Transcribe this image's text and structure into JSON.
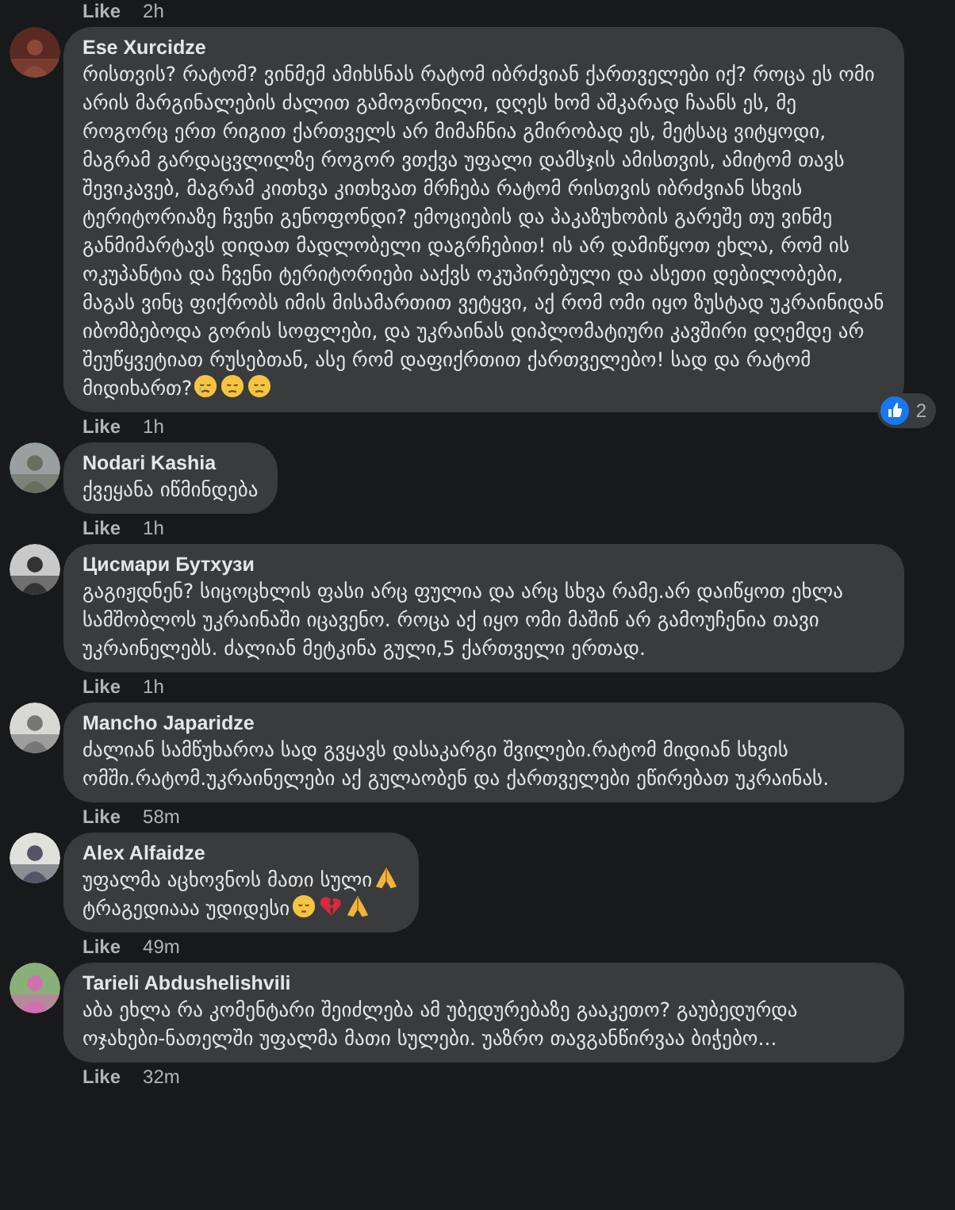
{
  "top_meta": {
    "like": "Like",
    "time": "2h"
  },
  "comments": [
    {
      "author": "Ese Xurcidze",
      "body": "რისთვის? რატომ? ვინმემ ამიხსნას რატომ იბრძვიან ქართველები იქ? როცა ეს ომი არის მარგინალების ძალით გამოგონილი, დღეს ხომ აშკარად ჩაანს ეს, მე როგორც ერთ რიგით ქართველს არ მიმაჩნია გმირობად ეს, მეტსაც ვიტყოდი, მაგრამ გარდაცვლილზე როგორ ვთქვა უფალი დამსჯის ამისთვის, ამიტომ თავს შევიკავებ, მაგრამ კითხვა კითხვათ მრჩება რატომ რისთვის იბრძვიან სხვის ტერიტორიაზე ჩვენი გენოფონდი? ემოციების და პაკაზუხობის გარეშე თუ ვინმე განმიმარტავს დიდათ მადლობელი დაგრჩებით! ის არ დამიწყოთ ეხლა, რომ ის ოკუპანტია და ჩვენი ტერიტორიები ააქვს ოკუპირებული და ასეთი დებილობები, მაგას ვინც ფიქრობს იმის მისამართით ვეტყვი, აქ რომ ომი იყო ზუსტად უკრაინიდან იბომბებოდა გორის სოფლები, და უკრაინას დიპლომატიური კავშირი დღემდე არ შეუწყვეტიათ რუსებთან, ასე რომ დაფიქრთით ქართველებო! სად და რატომ მიდიხართ?",
      "emoji": [
        {
          "kind": "crying"
        },
        {
          "kind": "sad"
        },
        {
          "kind": "sad"
        }
      ],
      "like": "Like",
      "time": "1h",
      "reaction_count": "2"
    },
    {
      "author": "Nodari Kashia",
      "body": "ქვეყანა იწმინდება",
      "like": "Like",
      "time": "1h"
    },
    {
      "author": "Цисмари Бутхузи",
      "body": "გაგიჟდნენ? სიცოცხლის ფასი არც ფულია და არც სხვა რამე.არ დაიწყოთ ეხლა სამშობლოს უკრაინაში იცავენო. როცა აქ იყო ომი მაშინ არ გამოუჩენია თავი უკრაინელებს. ძალიან მეტკინა გული,5 ქართველი ერთად.",
      "like": "Like",
      "time": "1h"
    },
    {
      "author": "Mancho Japaridze",
      "body": "ძალიან სამწუხაროა სად გვყავს დასაკარგი შვილები.რატომ მიდიან სხვის ომში.რატომ.უკრაინელები აქ გულაობენ და ქართველები ეწირებათ უკრაინას.",
      "like": "Like",
      "time": "58m"
    },
    {
      "author": "Alex Alfaidze",
      "body": "უფალმა აცხოვნოს მათი სული",
      "emoji": [
        {
          "kind": "pray"
        }
      ],
      "body2": "ტრაგედიააა უდიდესი",
      "emoji2": [
        {
          "kind": "sleepy"
        },
        {
          "kind": "broken_heart"
        },
        {
          "kind": "pray"
        }
      ],
      "like": "Like",
      "time": "49m"
    },
    {
      "author": "Tarieli Abdushelishvili",
      "body": "აბა ეხლა რა კომენტარი შეიძლება ამ უბედურებაზე გააკეთო? გაუბედურდა ოჯახები-ნათელში უფალმა მათი სულები. უაზრო თავგანწირვაა ბიჭებო...",
      "like": "Like",
      "time": "32m"
    }
  ]
}
